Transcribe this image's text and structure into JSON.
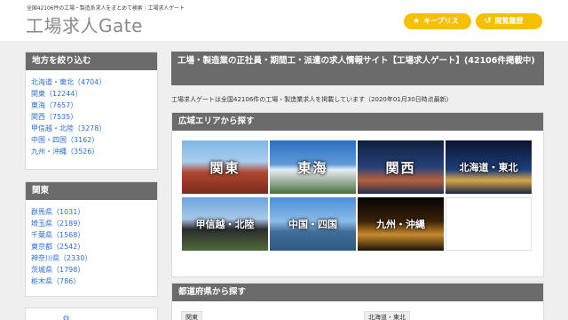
{
  "header": {
    "tagline": "全国42106件の工場・製造系求人をまとめて検索｜工場求人ゲート",
    "logo": "工場求人Gate",
    "keep_label": "キープリスト",
    "history_label": "閲覧履歴"
  },
  "sidebar": {
    "region_title": "地方を絞り込む",
    "regions": [
      "北海道・東北（4704）",
      "関東（12244）",
      "東海（7657）",
      "関西（7535）",
      "甲信越・北陸（3278）",
      "中国・四国（3162）",
      "九州・沖縄（3526）"
    ],
    "kanto_title": "関東",
    "kanto_prefs": [
      "群馬県（1031）",
      "埼玉県（2189）",
      "千葉県（1568）",
      "東京都（2542）",
      "神奈川県（2330）",
      "茨城県（1798）",
      "栃木県（786）"
    ]
  },
  "main": {
    "title": "工場・製造業の正社員・期間工・派遣の求人情報サイト【工場求人ゲート】(42106件掲載中)",
    "intro": "工場求人ゲートは全国42106件の工場・製造業求人を掲載しています（2020年01月30日時点最新）",
    "area_title": "広域エリアから探す",
    "tiles": [
      "関東",
      "東海",
      "関西",
      "北海道・東北",
      "甲信越・北陸",
      "中国・四国",
      "九州・沖縄"
    ],
    "pref_title": "都道府県から探す",
    "pref_tags": [
      "関東",
      "北海道・東北"
    ]
  },
  "colors": {
    "accent": "#f5c000",
    "header_bar": "#6b6b6b",
    "link": "#2e6fcb"
  }
}
